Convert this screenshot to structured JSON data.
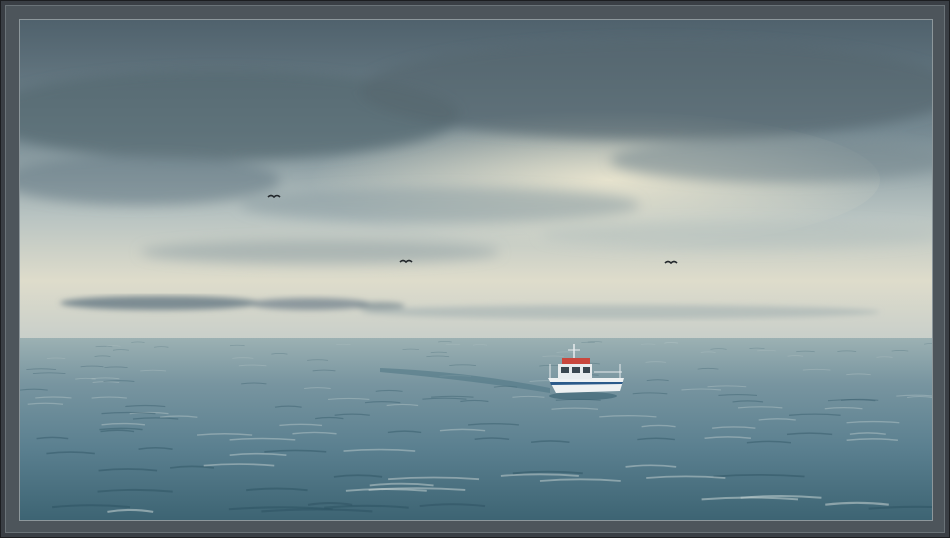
{
  "scene": {
    "subject": "",
    "colors": {
      "frame": "#3a3f45",
      "mat": "#4d555b",
      "sky_top": "#6c7f89",
      "sky_mid": "#a9b8bb",
      "horizon_glow": "#e6e2cf",
      "sea_far": "#8fa6aa",
      "sea_near": "#3f6a77",
      "boat_hull": "#f1f3f4",
      "boat_stripe": "#2b5a8a"
    },
    "icons": [
      "bird-icon",
      "boat-icon"
    ],
    "bird_count": 3
  }
}
